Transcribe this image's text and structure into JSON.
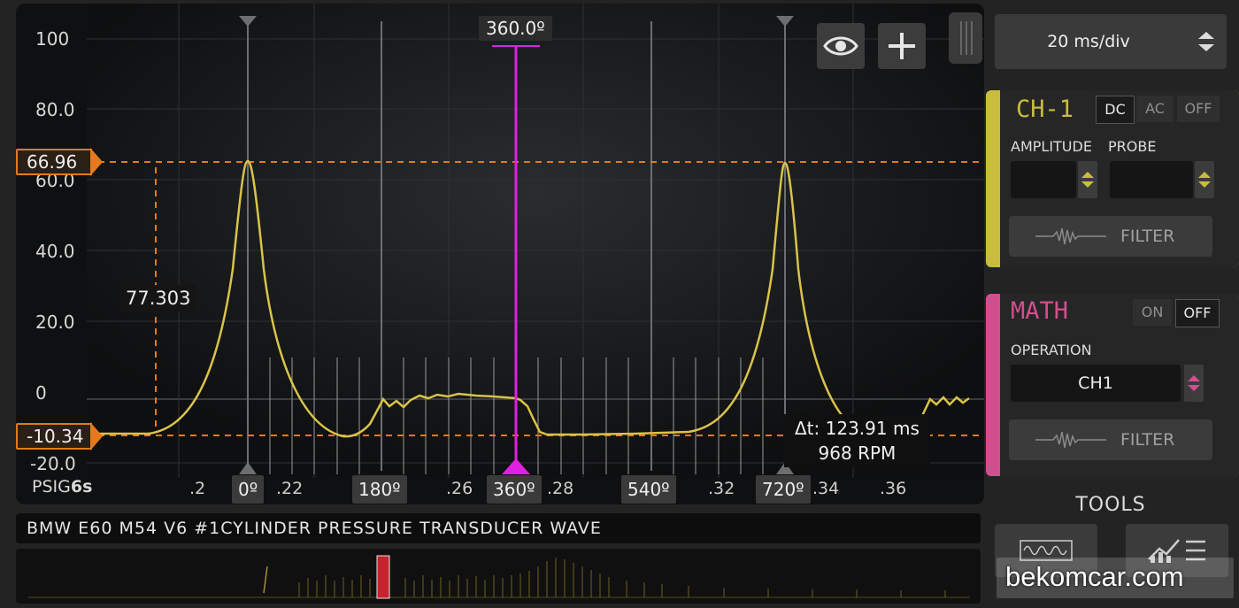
{
  "scope": {
    "y_axis_labels": [
      "100",
      "80.0",
      "60.0",
      "40.0",
      "20.0",
      "0",
      "-20.0"
    ],
    "x_axis_labels": [
      ".2",
      ".22",
      ".26",
      ".28",
      ".32",
      ".34",
      ".36"
    ],
    "unit_label": "PSIG",
    "time_label": "6s",
    "phase_caps": [
      "0º",
      "180º",
      "360º",
      "540º",
      "720º"
    ],
    "top_cursor_label": "360.0º",
    "cursor_high_value": "66.96",
    "cursor_low_value": "-10.34",
    "delta_value_label": "77.303",
    "delta_time": "Δt: 123.91 ms",
    "rpm": "968 RPM",
    "trace_color": "#d9c34a",
    "cursor_color": "#e47a1b",
    "phase_cursor_color": "#e020e0",
    "icons": {
      "visibility": "eye-icon",
      "add": "plus-icon"
    }
  },
  "caption": "BMW E60 M54 V6 #1CYLINDER PRESSURE TRANSDUCER WAVE",
  "timebase": {
    "value": "20 ms/div"
  },
  "ch1": {
    "title": "CH-1",
    "coupling": [
      "DC",
      "AC",
      "OFF"
    ],
    "selected_coupling": "DC",
    "amplitude_label": "AMPLITUDE",
    "probe_label": "PROBE",
    "amplitude_value": "",
    "probe_value": "",
    "filter_label": "FILTER",
    "accent": "#c9bd3e"
  },
  "math": {
    "title": "MATH",
    "toggle": [
      "ON",
      "OFF"
    ],
    "operation_label": "OPERATION",
    "operation_value": "CH1",
    "filter_label": "FILTER",
    "accent": "#d24f8e"
  },
  "tools": {
    "title": "TOOLS"
  },
  "watermark": "bekomcar.com"
}
